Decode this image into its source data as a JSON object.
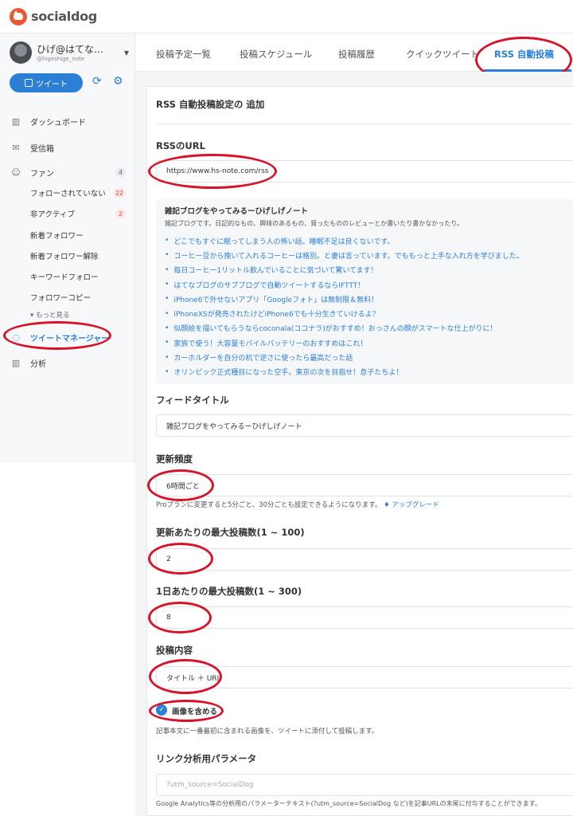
{
  "app": {
    "logo_text": "socialdog"
  },
  "account": {
    "name": "ひげ@はてな…",
    "handle": "@higeshige_note"
  },
  "sidebar": {
    "tweet_button": "ツイート",
    "items": [
      {
        "label": "ダッシュボード",
        "icon": "bar-chart-icon"
      },
      {
        "label": "受信箱",
        "icon": "inbox-icon"
      },
      {
        "label": "ファン",
        "icon": "users-icon",
        "badge": "4"
      },
      {
        "label": "ツイートマネージャー",
        "icon": "speech-bubble-icon"
      },
      {
        "label": "分析",
        "icon": "bar-chart-icon"
      }
    ],
    "fan_sub": [
      {
        "label": "フォローされていない",
        "badge": "22"
      },
      {
        "label": "非アクティブ",
        "badge": "2"
      },
      {
        "label": "新着フォロワー"
      },
      {
        "label": "新着フォロワー解除"
      },
      {
        "label": "キーワードフォロー"
      },
      {
        "label": "フォロワーコピー"
      }
    ],
    "more": "もっと見る"
  },
  "tabs": [
    {
      "label": "投稿予定一覧"
    },
    {
      "label": "投稿スケジュール"
    },
    {
      "label": "投稿履歴"
    },
    {
      "label": "クイックツイート"
    },
    {
      "label": "RSS 自動投稿"
    }
  ],
  "form": {
    "section_title": "RSS 自動投稿設定の 追加",
    "rss_url_label": "RSSのURL",
    "rss_url_value": "https://www.hs-note.com/rss",
    "feed": {
      "title": "雑記ブログをやってみるーひげしげノート",
      "desc": "雑記ブログです。日記的なもの、興味のあるもの、買ったもののレビューとか書いたり書かなかったり。",
      "items": [
        "どこでもすぐに眠ってしまう人の怖い話。睡眠不足は良くないです。",
        "コーヒー豆から挽いて入れるコーヒーは格別。と妻は言っています。でももっと上手な入れ方を学びました。",
        "毎日コーヒー1リットル飲んでいることに気づいて驚いてます！",
        "はてなブログのサブブログで自動ツイートするならIFTTT！",
        "iPhone6で外せないアプリ「Googleフォト」は無制限＆無料！",
        "iPhoneXSが発売されたけどiPhone6でも十分生きていけるよ？",
        "似顔絵を描いてもらうならcoconala(ココナラ)がおすすめ！おっさんの顔がスマートな仕上がりに！",
        "家族で使う！大容量モバイルバッテリーのおすすめはこれ！",
        "カーホルダーを自分の机で逆さに使ったら最高だった話",
        "オリンピック正式種目になった空手。東京の次を目指せ！息子たちよ！"
      ]
    },
    "feed_title_label": "フィードタイトル",
    "feed_title_value": "雑記ブログをやってみるーひげしげノート",
    "frequency_label": "更新頻度",
    "frequency_value": "6時間ごと",
    "frequency_help": "Proプランに変更すると5分ごと、30分ごとも設定できるようになります。",
    "upgrade": "アップグレード",
    "max_per_update_label": "更新あたりの最大投稿数(1 ~ 100)",
    "max_per_update_value": "2",
    "max_per_day_label": "1日あたりの最大投稿数(1 ~ 300)",
    "max_per_day_value": "8",
    "content_label": "投稿内容",
    "content_value": "タイトル ＋ URL",
    "include_image_label": "画像を含める",
    "include_image_help": "記事本文に一番最初に含まれる画像を、ツイートに添付して投稿します。",
    "link_param_label": "リンク分析用パラメータ",
    "link_param_placeholder": "?utm_source=SocialDog",
    "link_param_help": "Google Analytics等の分析用のパラメーターテキスト(?utm_source=SocialDog など)を記事URLの末尾に付与することができます。"
  },
  "colors": {
    "accent": "#2c7fd6",
    "annotation": "#d7132a",
    "brand": "#e95a33"
  }
}
